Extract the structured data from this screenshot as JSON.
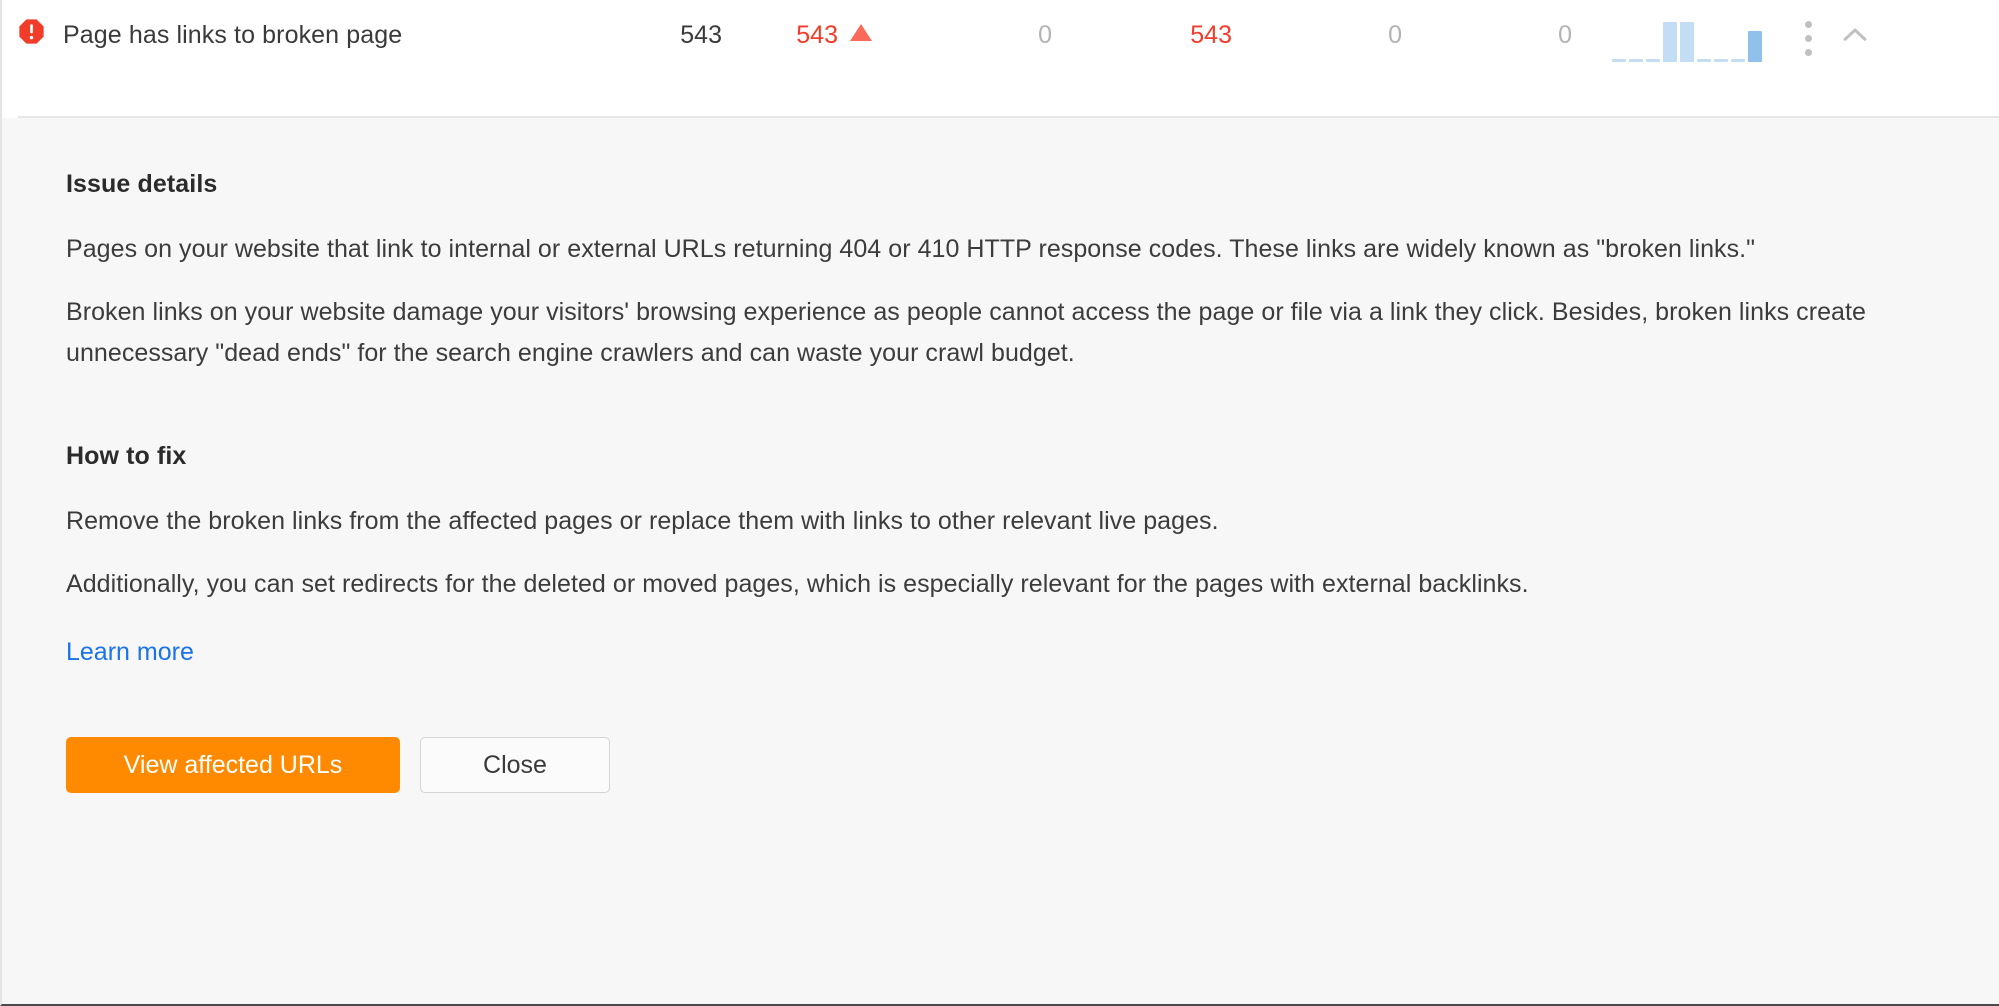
{
  "row": {
    "status_icon": "error-octagon-icon",
    "status_color": "#f13c2a",
    "title": "Page has links to broken page",
    "metrics": [
      {
        "name": "total",
        "value": "543",
        "tone": "default"
      },
      {
        "name": "new",
        "value": "543",
        "tone": "red",
        "delta": "up"
      },
      {
        "name": "broken",
        "value": "0",
        "tone": "muted"
      },
      {
        "name": "fixed",
        "value": "543",
        "tone": "red"
      },
      {
        "name": "ignored",
        "value": "0",
        "tone": "muted"
      },
      {
        "name": "other",
        "value": "0",
        "tone": "muted"
      }
    ],
    "kebab_icon": "more-vertical-icon",
    "collapse_icon": "chevron-up-icon"
  },
  "chart_data": {
    "type": "bar",
    "title": "",
    "categories": [
      "1",
      "2",
      "3",
      "4",
      "5",
      "6",
      "7",
      "8",
      "9"
    ],
    "values": [
      3,
      3,
      3,
      100,
      100,
      5,
      3,
      3,
      78
    ],
    "accent_index": 8,
    "colors": {
      "bar": "#c2ddf4",
      "accent": "#8fc1ea"
    },
    "xlabel": "",
    "ylabel": "",
    "ylim": [
      0,
      100
    ],
    "grid": false,
    "legend": "none"
  },
  "panel": {
    "issue_details_heading": "Issue details",
    "issue_details_paragraphs": [
      "Pages on your website that link to internal or external URLs returning 404 or 410 HTTP response codes. These links are widely known as \"broken links.\"",
      "Broken links on your website damage your visitors' browsing experience as people cannot access the page or file via a link they click. Besides, broken links create unnecessary \"dead ends\" for the search engine crawlers and can waste your crawl budget."
    ],
    "how_to_fix_heading": "How to fix",
    "how_to_fix_paragraphs": [
      "Remove the broken links from the affected pages or replace them with links to other relevant live pages.",
      "Additionally, you can set redirects for the deleted or moved pages, which is especially relevant for the pages with external backlinks."
    ],
    "learn_more_label": "Learn more",
    "primary_button_label": "View affected URLs",
    "secondary_button_label": "Close",
    "primary_button_color": "#ff8a00",
    "link_color": "#1a73e8"
  }
}
